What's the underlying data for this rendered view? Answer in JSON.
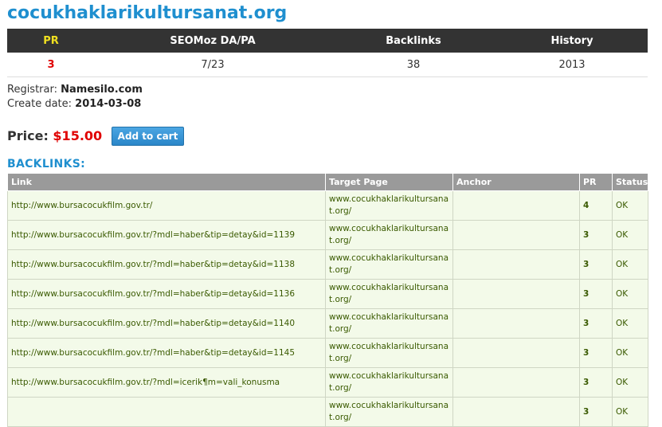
{
  "domain": "cocukhaklarikultursanat.org",
  "stats": {
    "headers": {
      "pr": "PR",
      "seomoz": "SEOMoz DA/PA",
      "backlinks": "Backlinks",
      "history": "History"
    },
    "values": {
      "pr": "3",
      "seomoz": "7/23",
      "backlinks": "38",
      "history": "2013"
    }
  },
  "registrar": {
    "label": "Registrar:",
    "value": "Namesilo.com"
  },
  "create_date": {
    "label": "Create date:",
    "value": "2014-03-08"
  },
  "price": {
    "label": "Price:",
    "amount": "$15.00"
  },
  "add_to_cart_label": "Add to cart",
  "backlinks_heading": "BACKLINKS:",
  "backlinks_table": {
    "headers": {
      "link": "Link",
      "target": "Target Page",
      "anchor": "Anchor",
      "pr": "PR",
      "status": "Status"
    },
    "rows": [
      {
        "link": "http://www.bursacocukfilm.gov.tr/",
        "target": "www.cocukhaklarikultursanat.org/",
        "anchor": "",
        "pr": "4",
        "status": "OK"
      },
      {
        "link": "http://www.bursacocukfilm.gov.tr/?mdl=haber&tip=detay&id=1139",
        "target": "www.cocukhaklarikultursanat.org/",
        "anchor": "",
        "pr": "3",
        "status": "OK"
      },
      {
        "link": "http://www.bursacocukfilm.gov.tr/?mdl=haber&tip=detay&id=1138",
        "target": "www.cocukhaklarikultursanat.org/",
        "anchor": "",
        "pr": "3",
        "status": "OK"
      },
      {
        "link": "http://www.bursacocukfilm.gov.tr/?mdl=haber&tip=detay&id=1136",
        "target": "www.cocukhaklarikultursanat.org/",
        "anchor": "",
        "pr": "3",
        "status": "OK"
      },
      {
        "link": "http://www.bursacocukfilm.gov.tr/?mdl=haber&tip=detay&id=1140",
        "target": "www.cocukhaklarikultursanat.org/",
        "anchor": "",
        "pr": "3",
        "status": "OK"
      },
      {
        "link": "http://www.bursacocukfilm.gov.tr/?mdl=haber&tip=detay&id=1145",
        "target": "www.cocukhaklarikultursanat.org/",
        "anchor": "",
        "pr": "3",
        "status": "OK"
      },
      {
        "link": "http://www.bursacocukfilm.gov.tr/?mdl=icerik¶m=vali_konusma",
        "target": "www.cocukhaklarikultursanat.org/",
        "anchor": "",
        "pr": "3",
        "status": "OK"
      },
      {
        "link": "",
        "target": "www.cocukhaklarikultursanat.org/",
        "anchor": "",
        "pr": "3",
        "status": "OK"
      }
    ]
  }
}
